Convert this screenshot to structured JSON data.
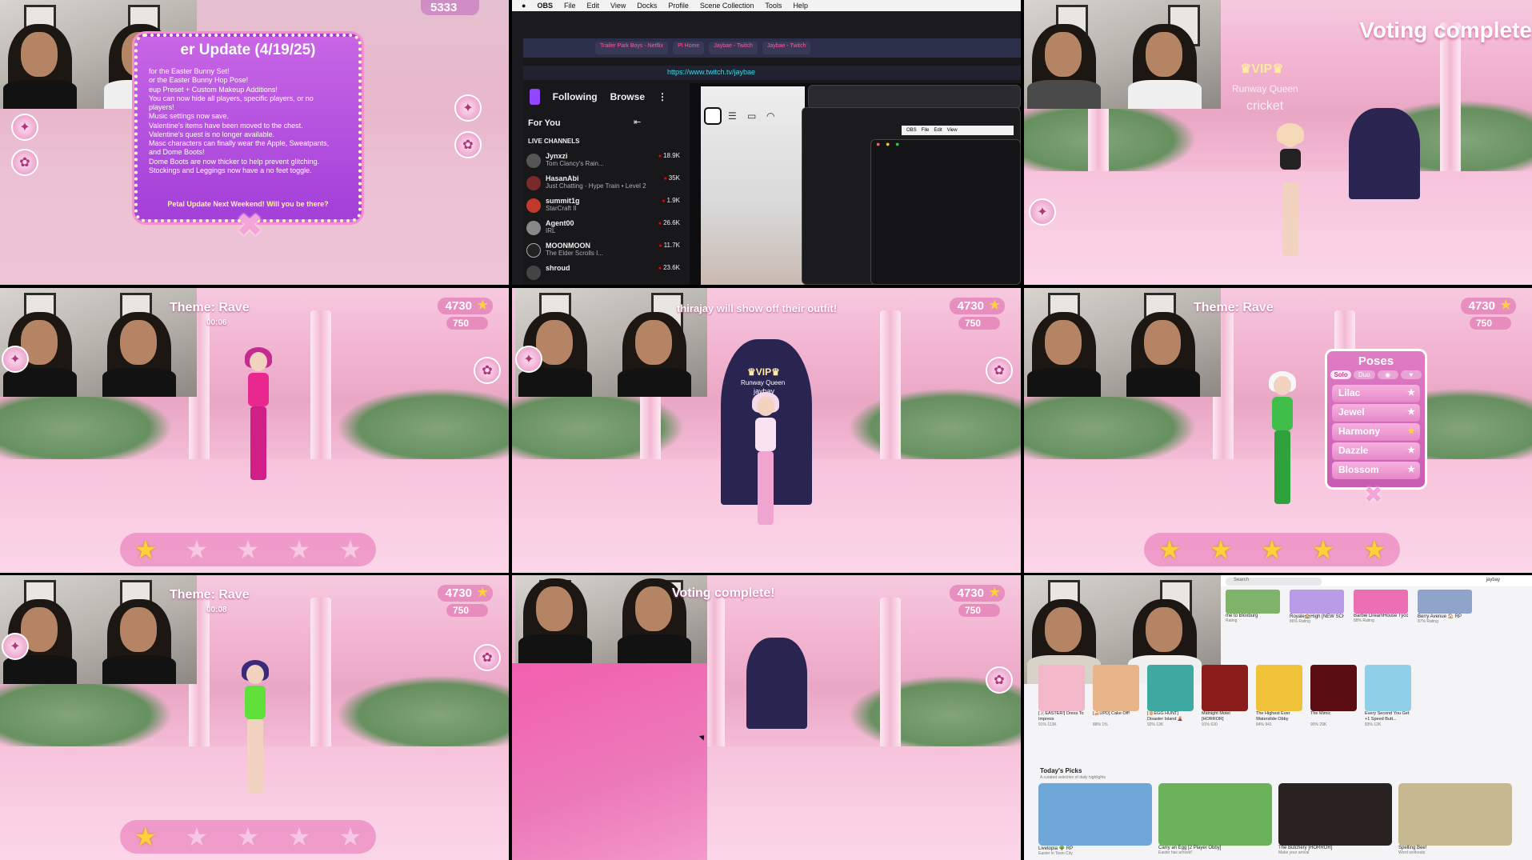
{
  "tile1": {
    "coins": "5333",
    "popup_title": "er Update (4/19/25)",
    "popup_lines": [
      "for the Easter Bunny Set!",
      "or the Easter Bunny Hop Pose!",
      "eup Preset + Custom Makeup Additions!",
      "You can now hide all players, specific players, or no",
      "players!",
      "Music settings now save.",
      "Valentine's items have been moved to the chest.",
      "Valentine's quest is no longer available.",
      "Masc characters can finally wear the Apple, Sweatpants,",
      "and Dome Boots!",
      "Dome Boots are now thicker to help prevent glitching.",
      "Stockings and Leggings now have a no feet toggle."
    ],
    "popup_footer": "Petal Update Next Weekend! Will you be there?",
    "close_glyph": "✖"
  },
  "tile2": {
    "menu": [
      "OBS",
      "File",
      "Edit",
      "View",
      "Docks",
      "Profile",
      "Scene Collection",
      "Tools",
      "Help"
    ],
    "tabs": [
      "Trailer Park Boys - Netflix",
      "PI Home",
      "Jaybae - Twitch",
      "Jaybae - Twitch"
    ],
    "url": "https://www.twitch.tv/jaybae",
    "nav_following": "Following",
    "nav_browse": "Browse",
    "for_you": "For You",
    "live_channels": "LIVE CHANNELS",
    "channels": [
      {
        "name": "Jynxzi",
        "game": "Tom Clancy's Rain...",
        "viewers": "18.9K"
      },
      {
        "name": "HasanAbi",
        "game": "Just Chatting · Hype Train • Level 2",
        "viewers": "35K"
      },
      {
        "name": "summit1g",
        "game": "StarCraft II",
        "viewers": "1.9K"
      },
      {
        "name": "Agent00",
        "game": "IRL",
        "viewers": "26.6K"
      },
      {
        "name": "MOONMOON",
        "game": "The Elder Scrolls I...",
        "viewers": "11.7K"
      },
      {
        "name": "shroud",
        "game": "",
        "viewers": "23.6K"
      }
    ],
    "obs_mini_menu": [
      "OBS",
      "File",
      "Edit",
      "View"
    ]
  },
  "tile3": {
    "voting_title": "Voting complete",
    "vip": "♛VIP♛",
    "runway": "Runway Queen",
    "winner": "cricket"
  },
  "tile4": {
    "theme": "Theme: Rave",
    "timer": "00:06",
    "coins": "4730",
    "gems": "750",
    "stars_on": 1
  },
  "tile5": {
    "banner": "thirajay will show off their outfit!",
    "coins": "4730",
    "gems": "750",
    "vip": "♛VIP♛",
    "runway": "Runway Queen",
    "name": "jaybay"
  },
  "tile6": {
    "theme": "Theme: Rave",
    "coins": "4730",
    "gems": "750",
    "poses_title": "Poses",
    "pose_tabs": [
      "Solo",
      "Duo",
      "",
      ""
    ],
    "poses": [
      "Lilac",
      "Jewel",
      "Harmony",
      "Dazzle",
      "Blossom"
    ],
    "favorite_pose": "Harmony",
    "stars_on": 5
  },
  "tile7": {
    "theme": "Theme: Rave",
    "timer": "00:08",
    "coins": "4730",
    "gems": "750",
    "stars_on": 1
  },
  "tile8": {
    "voting_title": "Voting complete!",
    "coins": "4730",
    "gems": "750"
  },
  "tile9": {
    "search_placeholder": "Search",
    "user": "jaybay",
    "row1": [
      {
        "name": "me to Bloxburg",
        "rating": "Rating"
      },
      {
        "name": "Royale🏫High [NEW SCHOOL!]",
        "rating": "86% Rating"
      },
      {
        "name": "Barbie DreamHouse Tycoon",
        "rating": "88% Rating"
      },
      {
        "name": "Berry Avenue 🏠 RP",
        "rating": "87% Rating"
      }
    ],
    "row2": [
      {
        "name": "[🐰EASTER!] Dress To Impress",
        "rating": "91%  113K"
      },
      {
        "name": "[🍰UPD] Cake Off!",
        "rating": "88%  1%"
      },
      {
        "name": "[🥚EGG HUNT] Disaster Island 🌋",
        "rating": "92%  13K"
      },
      {
        "name": "Midnight Motel [HORROR]",
        "rating": "91%  630"
      },
      {
        "name": "The Highest Ever Waterslide Obby",
        "rating": "84%  941"
      },
      {
        "name": "The Mimic",
        "rating": "90%  29K"
      },
      {
        "name": "Every Second You Get +1 Speed Butt...",
        "rating": "83%  12K"
      }
    ],
    "picks_title": "Today's Picks",
    "picks_sub": "A curated selection of daily highlights",
    "row3": [
      {
        "name": "Livetopia 🌳 RP",
        "rating": "Easter in Town City"
      },
      {
        "name": "Carry an Egg [2 Player Obby]",
        "rating": "Easter has arrived!"
      },
      {
        "name": "The Butchery [HORROR]",
        "rating": "Make your arrival"
      },
      {
        "name": "Spelling Bee!",
        "rating": "Word workouts"
      }
    ]
  },
  "colors": {
    "accent_pink": "#f25fae",
    "twitch_purple": "#9147ff",
    "star_gold": "#ffd23a"
  }
}
